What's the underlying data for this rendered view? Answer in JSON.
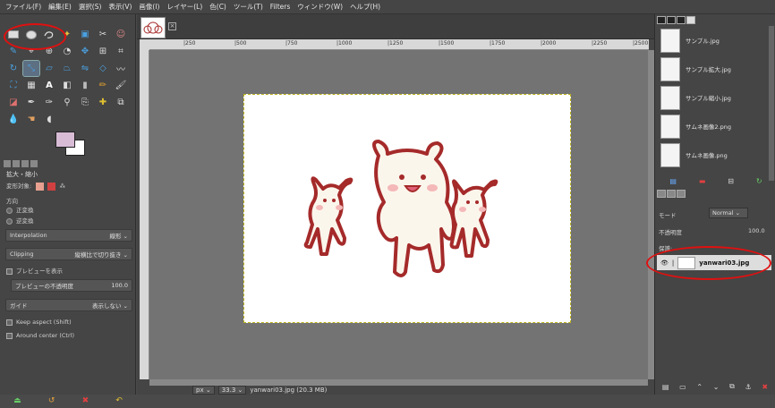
{
  "menubar": {
    "items": [
      "ファイル(F)",
      "編集(E)",
      "選択(S)",
      "表示(V)",
      "画像(I)",
      "レイヤー(L)",
      "色(C)",
      "ツール(T)",
      "Filters",
      "ウィンドウ(W)",
      "ヘルプ(H)"
    ]
  },
  "tool_options": {
    "title": "拡大・縮小",
    "transform_label": "変形対象:",
    "direction_label": "方向",
    "direction_options": [
      "正変換",
      "逆変換"
    ],
    "interpolation_label": "Interpolation",
    "interpolation_value": "線形",
    "clipping_label": "Clipping",
    "clipping_value": "縦横比で切り抜き",
    "preview_label": "プレビューを表示",
    "preview_opacity_label": "プレビューの不透明度",
    "preview_opacity_value": "100.0",
    "guide_label": "ガイド",
    "guide_value": "表示しない",
    "keep_aspect_label": "Keep aspect (Shift)",
    "around_center_label": "Around center (Ctrl)"
  },
  "statusbar": {
    "unit": "px",
    "zoom": "33.3",
    "file_info": "yanwari03.jpg (20.3 MB)"
  },
  "ruler": {
    "ticks": [
      "|250",
      "|500",
      "|750",
      "|1000",
      "|1250",
      "|1500",
      "|1750",
      "|2000",
      "|2250",
      "|2500"
    ]
  },
  "documents": {
    "items": [
      "サンプル.jpg",
      "サンプル拡大.jpg",
      "サンプル縮小.jpg",
      "サムネ画像2.png",
      "サムネ画像.png"
    ]
  },
  "layers": {
    "mode_label": "モード",
    "mode_value": "Normal",
    "opacity_label": "不透明度",
    "opacity_value": "100.0",
    "lock_label": "保護:",
    "layer_name": "yanwari03.jpg"
  },
  "colors": {
    "foreground": "#d8bcd6",
    "background": "#ffffff",
    "annotation": "#e01010",
    "bear_outline": "#a52a2a"
  }
}
